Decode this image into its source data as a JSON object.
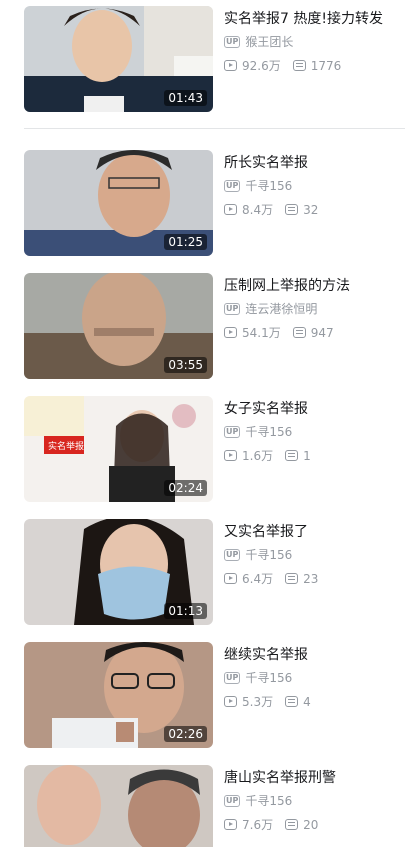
{
  "videos": [
    {
      "title": "实名举报7 热度!接力转发",
      "uploader": "猴王团长",
      "views": "92.6万",
      "danmaku": "1776",
      "duration": "01:43",
      "icon": "up-badge"
    },
    {
      "title": "所长实名举报",
      "uploader": "千寻156",
      "views": "8.4万",
      "danmaku": "32",
      "duration": "01:25",
      "icon": "up-badge"
    },
    {
      "title": "压制网上举报的方法",
      "uploader": "连云港徐恒明",
      "views": "54.1万",
      "danmaku": "947",
      "duration": "03:55",
      "icon": "up-badge"
    },
    {
      "title": "女子实名举报",
      "uploader": "千寻156",
      "views": "1.6万",
      "danmaku": "1",
      "duration": "02:24",
      "thumb_text": "实名举报",
      "icon": "up-badge"
    },
    {
      "title": "又实名举报了",
      "uploader": "千寻156",
      "views": "6.4万",
      "danmaku": "23",
      "duration": "01:13",
      "icon": "up-badge"
    },
    {
      "title": "继续实名举报",
      "uploader": "千寻156",
      "views": "5.3万",
      "danmaku": "4",
      "duration": "02:26",
      "icon": "up-badge"
    },
    {
      "title": "唐山实名举报刑警",
      "uploader": "千寻156",
      "views": "7.6万",
      "danmaku": "20",
      "duration": "",
      "icon": "up-badge"
    }
  ],
  "labels": {
    "up": "UP"
  }
}
